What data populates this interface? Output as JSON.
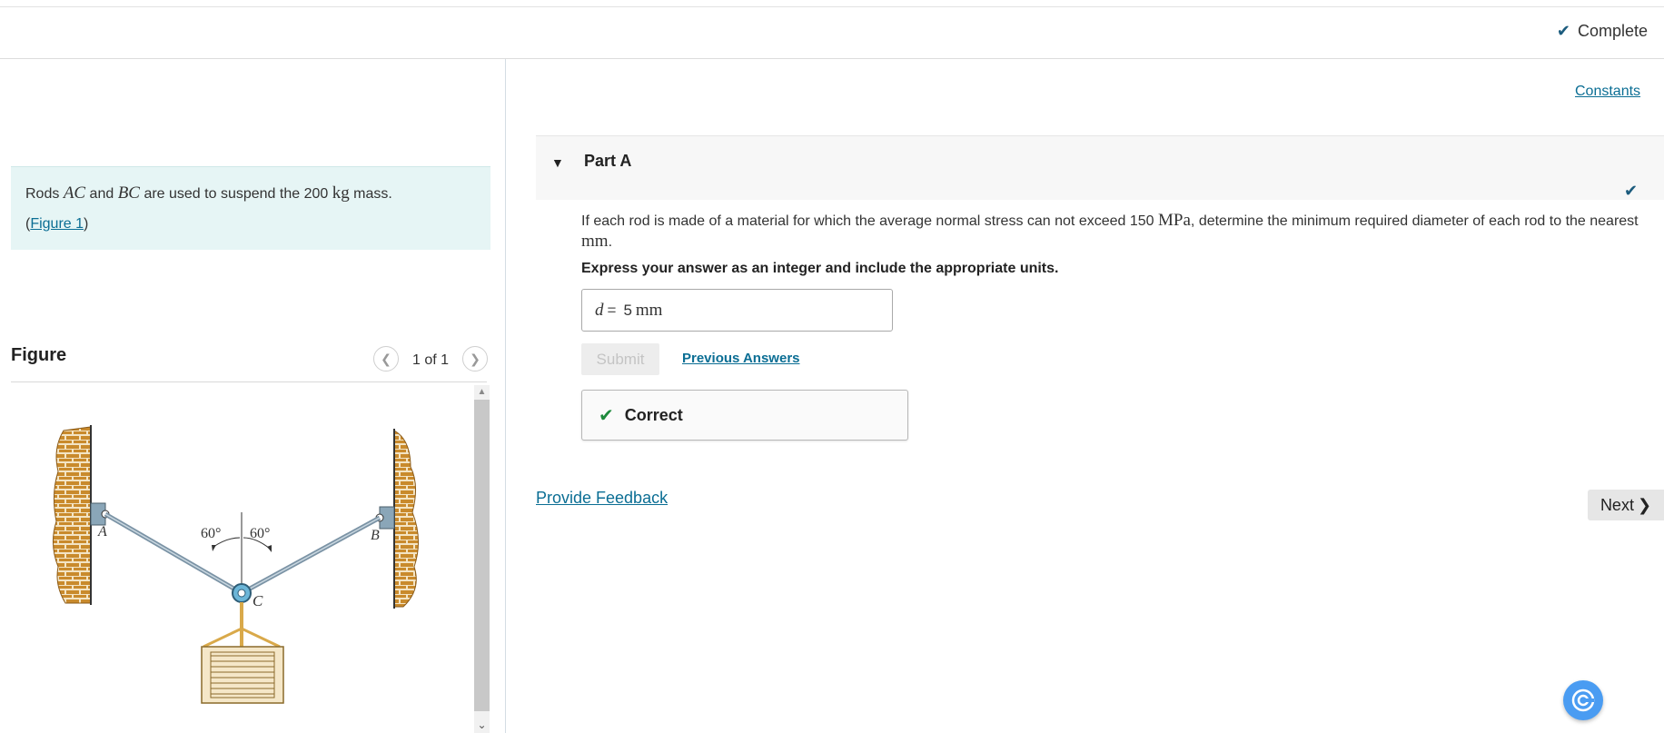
{
  "header": {
    "status_label": "Complete"
  },
  "problem": {
    "text_before": "Rods",
    "rod1": "AC",
    "text_and": "and",
    "rod2": "BC",
    "text_mid": "are used to suspend the 200",
    "mass_unit": "kg",
    "text_end": "mass.",
    "figure_link_open": "(",
    "figure_link": "Figure 1",
    "figure_link_close": ")"
  },
  "figure": {
    "title": "Figure",
    "page_count": "1 of 1",
    "label_a": "A",
    "label_b": "B",
    "label_c": "C",
    "angle_left": "60°",
    "angle_right": "60°"
  },
  "links": {
    "constants": "Constants",
    "previous_answers": "Previous Answers",
    "feedback": "Provide Feedback"
  },
  "part": {
    "title": "Part A",
    "question_before": "If each rod is made of a material for which the average normal stress can not exceed 150",
    "stress_unit": "MPa",
    "question_after": ", determine the minimum required diameter of each rod to the nearest",
    "question_unit": "mm",
    "question_end": ".",
    "instruction": "Express your answer as an integer and include the appropriate units.",
    "answer_var": "d",
    "answer_eq": "=",
    "answer_value": "5",
    "answer_unit": "mm",
    "submit_label": "Submit",
    "result_label": "Correct"
  },
  "nav": {
    "next_label": "Next"
  },
  "colors": {
    "accent": "#0b6e94",
    "check": "#1b5b7d",
    "correct": "#1e8a3c",
    "panel": "#e6f5f5"
  }
}
